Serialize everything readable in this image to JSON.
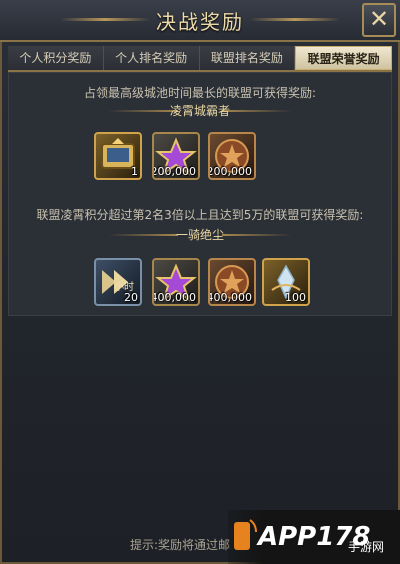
{
  "window": {
    "title": "决战奖励",
    "close_icon": "close-icon"
  },
  "tabs": [
    {
      "label": "个人积分奖励",
      "active": false
    },
    {
      "label": "个人排名奖励",
      "active": false
    },
    {
      "label": "联盟排名奖励",
      "active": false
    },
    {
      "label": "联盟荣誉奖励",
      "active": true
    }
  ],
  "section1": {
    "description": "占领最高级城池时间最长的联盟可获得奖励:",
    "title": "凌霄城霸者",
    "rewards": [
      {
        "icon": "throne-scroll-icon",
        "qty": "1"
      },
      {
        "icon": "purple-star-icon",
        "qty": "200,000"
      },
      {
        "icon": "bronze-star-medal-icon",
        "qty": "200,000"
      }
    ]
  },
  "section2": {
    "description": "联盟凌霄积分超过第2名3倍以上且达到5万的联盟可获得奖励:",
    "title": "一骑绝尘",
    "rewards": [
      {
        "icon": "speedup-arrow-icon",
        "qty": "20",
        "icon_text": "小时"
      },
      {
        "icon": "purple-star-icon",
        "qty": "400,000"
      },
      {
        "icon": "bronze-star-medal-icon",
        "qty": "400,000"
      },
      {
        "icon": "crystal-gem-icon",
        "qty": "100"
      }
    ]
  },
  "hint": "提示:奖励将通过邮",
  "watermark": {
    "text": "APP178",
    "cn": "手游网"
  },
  "colors": {
    "accent_gold": "#b8975a",
    "active_tab": "#f0e7cf",
    "panel": "#2b2f36"
  }
}
